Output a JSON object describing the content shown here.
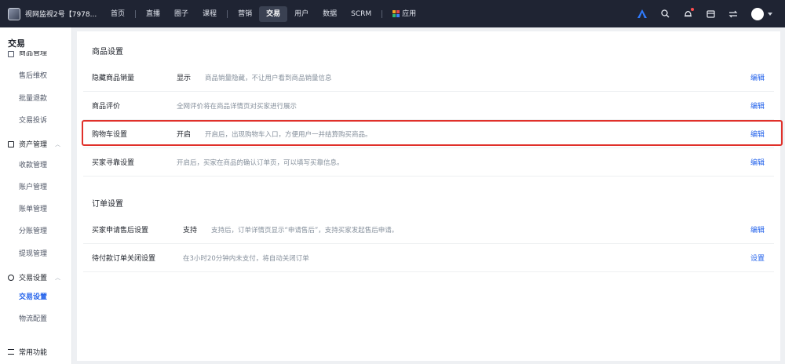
{
  "header": {
    "shop_name": "视网监视2号【7978...",
    "nav": [
      {
        "label": "首页"
      },
      {
        "label": "直播"
      },
      {
        "label": "圈子"
      },
      {
        "label": "课程"
      },
      {
        "label": "营销"
      },
      {
        "label": "交易",
        "active": true
      },
      {
        "label": "用户"
      },
      {
        "label": "数据"
      },
      {
        "label": "SCRM"
      },
      {
        "label": "应用"
      }
    ],
    "icons": [
      "logo-triangle-icon",
      "search-icon",
      "notification-icon",
      "calendar-icon",
      "switch-icon",
      "avatar"
    ]
  },
  "sidebar": {
    "title": "交易",
    "groups": {
      "goods": {
        "label": "商品管理"
      },
      "assets": {
        "label": "资产管理"
      },
      "trade": {
        "label": "交易设置"
      },
      "common": {
        "label": "常用功能"
      }
    },
    "items": {
      "after_sale": "售后维权",
      "batch_refund": "批量退款",
      "complaint": "交易投诉",
      "collection": "收款管理",
      "account": "账户管理",
      "bill": "账单管理",
      "split": "分账管理",
      "withdraw": "提现管理",
      "trade_settings": "交易设置",
      "logistics": "物流配置"
    }
  },
  "main": {
    "goods_section": {
      "title": "商品设置",
      "rows": [
        {
          "name": "隐藏商品销量",
          "status": "显示",
          "desc": "商品销量隐藏，不让用户看到商品销量信息",
          "action": "编辑"
        },
        {
          "name": "商品评价",
          "status": "",
          "desc": "全网评价将在商品详情页对买家进行展示",
          "action": "编辑"
        },
        {
          "name": "购物车设置",
          "status": "开启",
          "desc": "开启后，出现购物车入口，方便用户一并结算购买商品。",
          "action": "编辑"
        },
        {
          "name": "买家寻靠设置",
          "status": "",
          "desc": "开启后，买家在商品的确认订单页，可以填写买靠信息。",
          "action": "编辑"
        }
      ]
    },
    "order_section": {
      "title": "订单设置",
      "rows": [
        {
          "name": "买家申请售后设置",
          "status": "支持",
          "desc": "支持后，订单详情页显示“申请售后”，支持买家发起售后申请。",
          "action": "编辑"
        },
        {
          "name": "待付款订单关闭设置",
          "status": "",
          "desc": "在3小时20分钟内未支付，将自动关闭订单",
          "action": "设置"
        }
      ]
    }
  },
  "colors": {
    "topbar": "#1f2433",
    "accent": "#2463eb",
    "highlight_border": "#e0302a"
  }
}
